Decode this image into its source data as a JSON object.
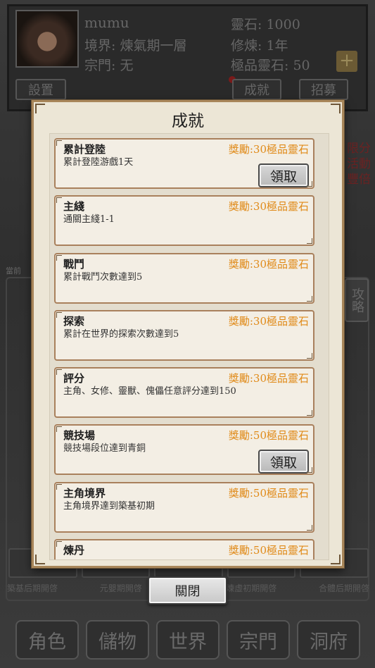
{
  "player": {
    "name": "mumu",
    "realm": "境界: 煉氣期一層",
    "sect": "宗門: 无",
    "spirit_stones": "靈石: 1000",
    "cultivation": "修煉: 1年",
    "premium_stones": "極品靈石: 50"
  },
  "header_buttons": {
    "settings": "設置",
    "achievements": "成就",
    "recruit": "招募"
  },
  "side": {
    "event_text": "限分活動豐倍",
    "guide": "攻略",
    "left_label": "當前"
  },
  "unlock_labels": [
    "築基后期開啓",
    "元嬰期開啓",
    "",
    "煉虛初期開啓",
    "合體后期開啓"
  ],
  "bottom_nav": [
    "角色",
    "儲物",
    "世界",
    "宗門",
    "洞府"
  ],
  "modal": {
    "title": "成就",
    "close_label": "關閉",
    "achievements": [
      {
        "name": "累計登陸",
        "reward": "獎勵:30極品靈石",
        "desc": "累計登陸游戲1天",
        "claim": "領取"
      },
      {
        "name": "主綫",
        "reward": "獎勵:30極品靈石",
        "desc": "通關主綫1-1",
        "claim": ""
      },
      {
        "name": "戰鬥",
        "reward": "獎勵:30極品靈石",
        "desc": "累計戰鬥次數達到5",
        "claim": ""
      },
      {
        "name": "探索",
        "reward": "獎勵:30極品靈石",
        "desc": "累計在世界的探索次數達到5",
        "claim": ""
      },
      {
        "name": "評分",
        "reward": "獎勵:30極品靈石",
        "desc": "主角、女修、靈獸、傀儡任意評分達到150",
        "claim": ""
      },
      {
        "name": "競技場",
        "reward": "獎勵:50極品靈石",
        "desc": "競技場段位達到青銅",
        "claim": "領取"
      },
      {
        "name": "主角境界",
        "reward": "獎勵:50極品靈石",
        "desc": "主角境界達到築基初期",
        "claim": ""
      },
      {
        "name": "煉丹",
        "reward": "獎勵:50極品靈石",
        "desc": "",
        "claim": ""
      }
    ]
  }
}
